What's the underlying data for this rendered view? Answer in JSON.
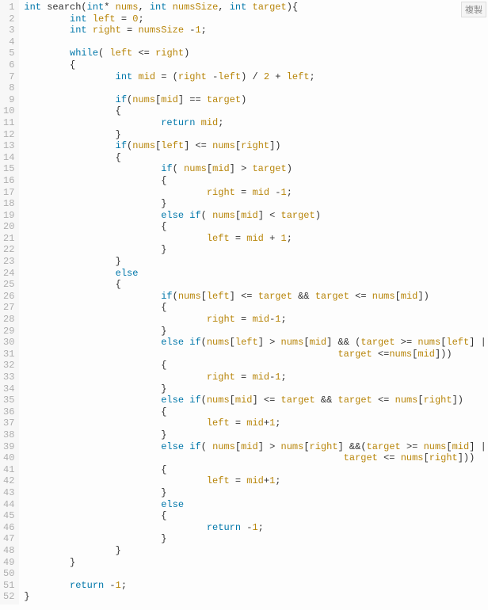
{
  "copy_label": "複製",
  "lines": [
    [
      [
        "kw",
        "int"
      ],
      [
        "id",
        " search("
      ],
      [
        "kw",
        "int"
      ],
      [
        "id",
        "* "
      ],
      [
        "var",
        "nums"
      ],
      [
        "id",
        ", "
      ],
      [
        "kw",
        "int"
      ],
      [
        "id",
        " "
      ],
      [
        "var",
        "numsSize"
      ],
      [
        "id",
        ", "
      ],
      [
        "kw",
        "int"
      ],
      [
        "id",
        " "
      ],
      [
        "var",
        "target"
      ],
      [
        "id",
        "){"
      ]
    ],
    [
      [
        "id",
        "        "
      ],
      [
        "kw",
        "int"
      ],
      [
        "id",
        " "
      ],
      [
        "var",
        "left"
      ],
      [
        "id",
        " = "
      ],
      [
        "num",
        "0"
      ],
      [
        "id",
        ";"
      ]
    ],
    [
      [
        "id",
        "        "
      ],
      [
        "kw",
        "int"
      ],
      [
        "id",
        " "
      ],
      [
        "var",
        "right"
      ],
      [
        "id",
        " = "
      ],
      [
        "var",
        "numsSize"
      ],
      [
        "id",
        " -"
      ],
      [
        "num",
        "1"
      ],
      [
        "id",
        ";"
      ]
    ],
    [
      [
        "id",
        ""
      ]
    ],
    [
      [
        "id",
        "        "
      ],
      [
        "kw",
        "while"
      ],
      [
        "id",
        "( "
      ],
      [
        "var",
        "left"
      ],
      [
        "id",
        " <= "
      ],
      [
        "var",
        "right"
      ],
      [
        "id",
        ")"
      ]
    ],
    [
      [
        "id",
        "        {"
      ]
    ],
    [
      [
        "id",
        "                "
      ],
      [
        "kw",
        "int"
      ],
      [
        "id",
        " "
      ],
      [
        "var",
        "mid"
      ],
      [
        "id",
        " = ("
      ],
      [
        "var",
        "right"
      ],
      [
        "id",
        " -"
      ],
      [
        "var",
        "left"
      ],
      [
        "id",
        ") / "
      ],
      [
        "num",
        "2"
      ],
      [
        "id",
        " + "
      ],
      [
        "var",
        "left"
      ],
      [
        "id",
        ";"
      ]
    ],
    [
      [
        "id",
        ""
      ]
    ],
    [
      [
        "id",
        "                "
      ],
      [
        "kw",
        "if"
      ],
      [
        "id",
        "("
      ],
      [
        "var",
        "nums"
      ],
      [
        "id",
        "["
      ],
      [
        "var",
        "mid"
      ],
      [
        "id",
        "] == "
      ],
      [
        "var",
        "target"
      ],
      [
        "id",
        ")"
      ]
    ],
    [
      [
        "id",
        "                {"
      ]
    ],
    [
      [
        "id",
        "                        "
      ],
      [
        "kw",
        "return"
      ],
      [
        "id",
        " "
      ],
      [
        "var",
        "mid"
      ],
      [
        "id",
        ";"
      ]
    ],
    [
      [
        "id",
        "                }"
      ]
    ],
    [
      [
        "id",
        "                "
      ],
      [
        "kw",
        "if"
      ],
      [
        "id",
        "("
      ],
      [
        "var",
        "nums"
      ],
      [
        "id",
        "["
      ],
      [
        "var",
        "left"
      ],
      [
        "id",
        "] <= "
      ],
      [
        "var",
        "nums"
      ],
      [
        "id",
        "["
      ],
      [
        "var",
        "right"
      ],
      [
        "id",
        "])"
      ]
    ],
    [
      [
        "id",
        "                {"
      ]
    ],
    [
      [
        "id",
        "                        "
      ],
      [
        "kw",
        "if"
      ],
      [
        "id",
        "( "
      ],
      [
        "var",
        "nums"
      ],
      [
        "id",
        "["
      ],
      [
        "var",
        "mid"
      ],
      [
        "id",
        "] > "
      ],
      [
        "var",
        "target"
      ],
      [
        "id",
        ")"
      ]
    ],
    [
      [
        "id",
        "                        {"
      ]
    ],
    [
      [
        "id",
        "                                "
      ],
      [
        "var",
        "right"
      ],
      [
        "id",
        " = "
      ],
      [
        "var",
        "mid"
      ],
      [
        "id",
        " -"
      ],
      [
        "num",
        "1"
      ],
      [
        "id",
        ";"
      ]
    ],
    [
      [
        "id",
        "                        }"
      ]
    ],
    [
      [
        "id",
        "                        "
      ],
      [
        "kw",
        "else"
      ],
      [
        "id",
        " "
      ],
      [
        "kw",
        "if"
      ],
      [
        "id",
        "( "
      ],
      [
        "var",
        "nums"
      ],
      [
        "id",
        "["
      ],
      [
        "var",
        "mid"
      ],
      [
        "id",
        "] < "
      ],
      [
        "var",
        "target"
      ],
      [
        "id",
        ")"
      ]
    ],
    [
      [
        "id",
        "                        {"
      ]
    ],
    [
      [
        "id",
        "                                "
      ],
      [
        "var",
        "left"
      ],
      [
        "id",
        " = "
      ],
      [
        "var",
        "mid"
      ],
      [
        "id",
        " + "
      ],
      [
        "num",
        "1"
      ],
      [
        "id",
        ";"
      ]
    ],
    [
      [
        "id",
        "                        }"
      ]
    ],
    [
      [
        "id",
        "                }"
      ]
    ],
    [
      [
        "id",
        "                "
      ],
      [
        "kw",
        "else"
      ]
    ],
    [
      [
        "id",
        "                {"
      ]
    ],
    [
      [
        "id",
        "                        "
      ],
      [
        "kw",
        "if"
      ],
      [
        "id",
        "("
      ],
      [
        "var",
        "nums"
      ],
      [
        "id",
        "["
      ],
      [
        "var",
        "left"
      ],
      [
        "id",
        "] <= "
      ],
      [
        "var",
        "target"
      ],
      [
        "id",
        " && "
      ],
      [
        "var",
        "target"
      ],
      [
        "id",
        " <= "
      ],
      [
        "var",
        "nums"
      ],
      [
        "id",
        "["
      ],
      [
        "var",
        "mid"
      ],
      [
        "id",
        "])"
      ]
    ],
    [
      [
        "id",
        "                        {"
      ]
    ],
    [
      [
        "id",
        "                                "
      ],
      [
        "var",
        "right"
      ],
      [
        "id",
        " = "
      ],
      [
        "var",
        "mid"
      ],
      [
        "id",
        "-"
      ],
      [
        "num",
        "1"
      ],
      [
        "id",
        ";"
      ]
    ],
    [
      [
        "id",
        "                        }"
      ]
    ],
    [
      [
        "id",
        "                        "
      ],
      [
        "kw",
        "else"
      ],
      [
        "id",
        " "
      ],
      [
        "kw",
        "if"
      ],
      [
        "id",
        "("
      ],
      [
        "var",
        "nums"
      ],
      [
        "id",
        "["
      ],
      [
        "var",
        "left"
      ],
      [
        "id",
        "] > "
      ],
      [
        "var",
        "nums"
      ],
      [
        "id",
        "["
      ],
      [
        "var",
        "mid"
      ],
      [
        "id",
        "] && ("
      ],
      [
        "var",
        "target"
      ],
      [
        "id",
        " >= "
      ],
      [
        "var",
        "nums"
      ],
      [
        "id",
        "["
      ],
      [
        "var",
        "left"
      ],
      [
        "id",
        "] ||"
      ]
    ],
    [
      [
        "id",
        "                                                       "
      ],
      [
        "var",
        "target"
      ],
      [
        "id",
        " <="
      ],
      [
        "var",
        "nums"
      ],
      [
        "id",
        "["
      ],
      [
        "var",
        "mid"
      ],
      [
        "id",
        "]))"
      ]
    ],
    [
      [
        "id",
        "                        {"
      ]
    ],
    [
      [
        "id",
        "                                "
      ],
      [
        "var",
        "right"
      ],
      [
        "id",
        " = "
      ],
      [
        "var",
        "mid"
      ],
      [
        "id",
        "-"
      ],
      [
        "num",
        "1"
      ],
      [
        "id",
        ";"
      ]
    ],
    [
      [
        "id",
        "                        }"
      ]
    ],
    [
      [
        "id",
        "                        "
      ],
      [
        "kw",
        "else"
      ],
      [
        "id",
        " "
      ],
      [
        "kw",
        "if"
      ],
      [
        "id",
        "("
      ],
      [
        "var",
        "nums"
      ],
      [
        "id",
        "["
      ],
      [
        "var",
        "mid"
      ],
      [
        "id",
        "] <= "
      ],
      [
        "var",
        "target"
      ],
      [
        "id",
        " && "
      ],
      [
        "var",
        "target"
      ],
      [
        "id",
        " <= "
      ],
      [
        "var",
        "nums"
      ],
      [
        "id",
        "["
      ],
      [
        "var",
        "right"
      ],
      [
        "id",
        "])"
      ]
    ],
    [
      [
        "id",
        "                        {"
      ]
    ],
    [
      [
        "id",
        "                                "
      ],
      [
        "var",
        "left"
      ],
      [
        "id",
        " = "
      ],
      [
        "var",
        "mid"
      ],
      [
        "id",
        "+"
      ],
      [
        "num",
        "1"
      ],
      [
        "id",
        ";"
      ]
    ],
    [
      [
        "id",
        "                        }"
      ]
    ],
    [
      [
        "id",
        "                        "
      ],
      [
        "kw",
        "else"
      ],
      [
        "id",
        " "
      ],
      [
        "kw",
        "if"
      ],
      [
        "id",
        "( "
      ],
      [
        "var",
        "nums"
      ],
      [
        "id",
        "["
      ],
      [
        "var",
        "mid"
      ],
      [
        "id",
        "] > "
      ],
      [
        "var",
        "nums"
      ],
      [
        "id",
        "["
      ],
      [
        "var",
        "right"
      ],
      [
        "id",
        "] &&("
      ],
      [
        "var",
        "target"
      ],
      [
        "id",
        " >= "
      ],
      [
        "var",
        "nums"
      ],
      [
        "id",
        "["
      ],
      [
        "var",
        "mid"
      ],
      [
        "id",
        "] ||"
      ]
    ],
    [
      [
        "id",
        "                                                        "
      ],
      [
        "var",
        "target"
      ],
      [
        "id",
        " <= "
      ],
      [
        "var",
        "nums"
      ],
      [
        "id",
        "["
      ],
      [
        "var",
        "right"
      ],
      [
        "id",
        "]))"
      ]
    ],
    [
      [
        "id",
        "                        {"
      ]
    ],
    [
      [
        "id",
        "                                "
      ],
      [
        "var",
        "left"
      ],
      [
        "id",
        " = "
      ],
      [
        "var",
        "mid"
      ],
      [
        "id",
        "+"
      ],
      [
        "num",
        "1"
      ],
      [
        "id",
        ";"
      ]
    ],
    [
      [
        "id",
        "                        }"
      ]
    ],
    [
      [
        "id",
        "                        "
      ],
      [
        "kw",
        "else"
      ]
    ],
    [
      [
        "id",
        "                        {"
      ]
    ],
    [
      [
        "id",
        "                                "
      ],
      [
        "kw",
        "return"
      ],
      [
        "id",
        " -"
      ],
      [
        "num",
        "1"
      ],
      [
        "id",
        ";"
      ]
    ],
    [
      [
        "id",
        "                        }"
      ]
    ],
    [
      [
        "id",
        "                }"
      ]
    ],
    [
      [
        "id",
        "        }"
      ]
    ],
    [
      [
        "id",
        ""
      ]
    ],
    [
      [
        "id",
        "        "
      ],
      [
        "kw",
        "return"
      ],
      [
        "id",
        " -"
      ],
      [
        "num",
        "1"
      ],
      [
        "id",
        ";"
      ]
    ],
    [
      [
        "id",
        "}"
      ]
    ]
  ]
}
